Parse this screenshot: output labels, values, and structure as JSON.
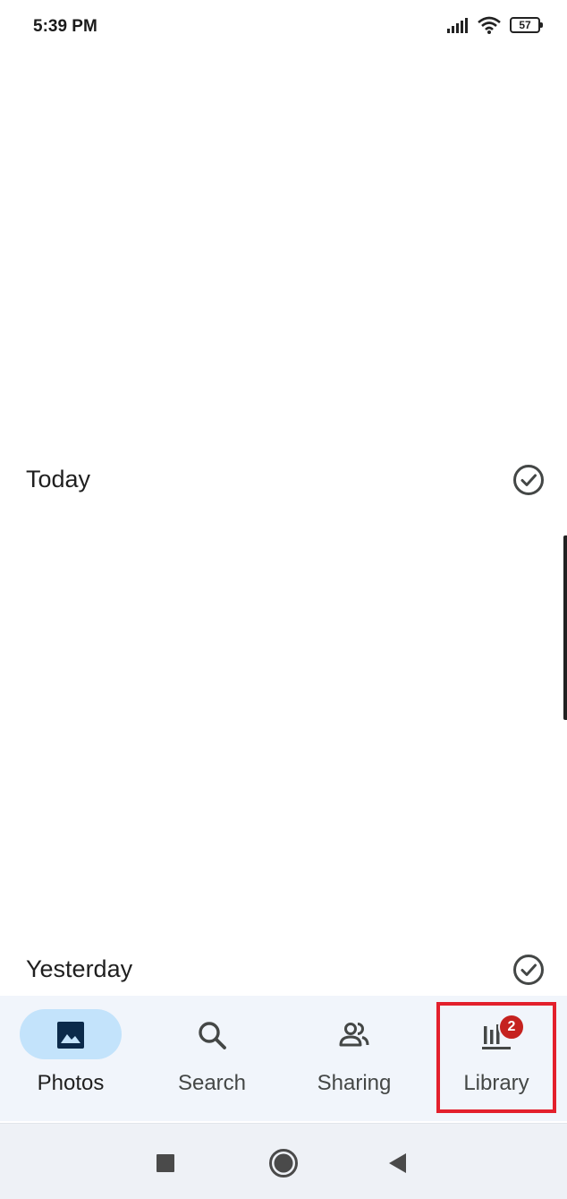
{
  "status_bar": {
    "time": "5:39 PM",
    "battery": "57",
    "icons": [
      "signal-icon",
      "wifi-icon",
      "battery-icon"
    ]
  },
  "sections": [
    {
      "title": "Today",
      "icon": "check-circle-icon"
    },
    {
      "title": "Yesterday",
      "icon": "check-circle-icon"
    }
  ],
  "bottom_nav": {
    "items": [
      {
        "label": "Photos",
        "icon": "photo-icon",
        "active": true
      },
      {
        "label": "Search",
        "icon": "search-icon",
        "active": false
      },
      {
        "label": "Sharing",
        "icon": "people-icon",
        "active": false
      },
      {
        "label": "Library",
        "icon": "library-icon",
        "active": false,
        "badge": "2"
      }
    ]
  },
  "system_nav": [
    "recents-button",
    "home-button",
    "back-button"
  ],
  "colors": {
    "active_pill": "#c3e3fb",
    "badge": "#c5221f",
    "highlight": "#e3202c",
    "nav_background": "#f1f5fb"
  }
}
